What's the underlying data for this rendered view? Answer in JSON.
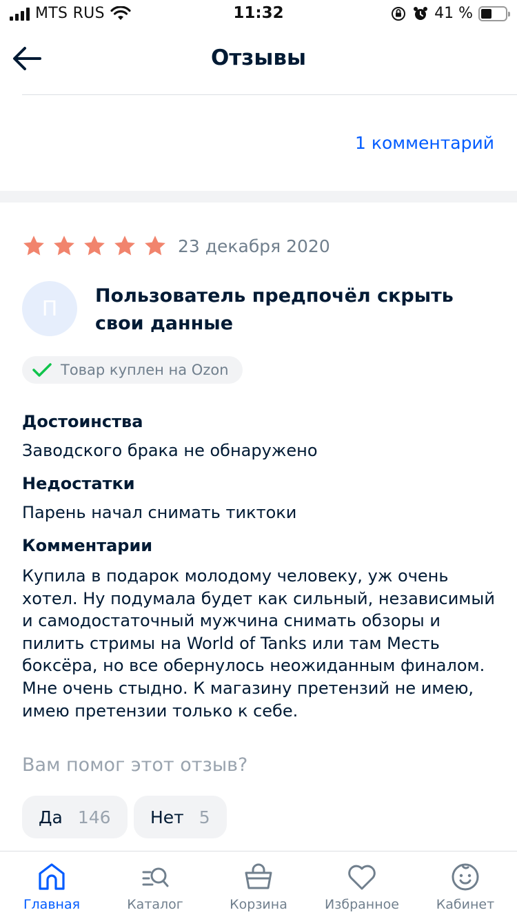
{
  "status_bar": {
    "carrier": "MTS RUS",
    "time": "11:32",
    "battery": "41 %"
  },
  "header": {
    "title": "Отзывы",
    "back_icon": "arrow-left-icon"
  },
  "comments_link": "1 комментарий",
  "review": {
    "rating": 5,
    "date": "23 декабря 2020",
    "avatar_initial": "П",
    "author": "Пользователь предпочёл скрыть свои данные",
    "purchase_badge": "Товар куплен на Ozon",
    "pros_title": "Достоинства",
    "pros_text": "Заводского брака не обнаружено",
    "cons_title": "Недостатки",
    "cons_text": "Парень начал снимать тиктоки",
    "comment_title": "Комментарии",
    "comment_text": "Купила в подарок молодому человеку, уж очень хотел. Ну подумала будет как сильный, независимый и самодостаточный мужчина снимать обзоры и пилить стримы на World of Tanks или там Месть боксёра, но все обернулось неожиданным финалом. Мне очень стыдно. К магазину претензий не имею, имею претензии только к себе."
  },
  "helpful": {
    "question": "Вам помог этот отзыв?",
    "yes_label": "Да",
    "yes_count": "146",
    "no_label": "Нет",
    "no_count": "5"
  },
  "tab_bar": {
    "items": [
      {
        "label": "Главная",
        "icon": "home-icon",
        "active": true
      },
      {
        "label": "Каталог",
        "icon": "catalog-search-icon",
        "active": false
      },
      {
        "label": "Корзина",
        "icon": "basket-icon",
        "active": false
      },
      {
        "label": "Избранное",
        "icon": "heart-icon",
        "active": false
      },
      {
        "label": "Кабинет",
        "icon": "smiley-icon",
        "active": false
      }
    ]
  },
  "colors": {
    "accent": "#005bff",
    "star": "#f1846d",
    "check": "#10c44c",
    "text": "#001a34",
    "muted": "#707f8d"
  }
}
